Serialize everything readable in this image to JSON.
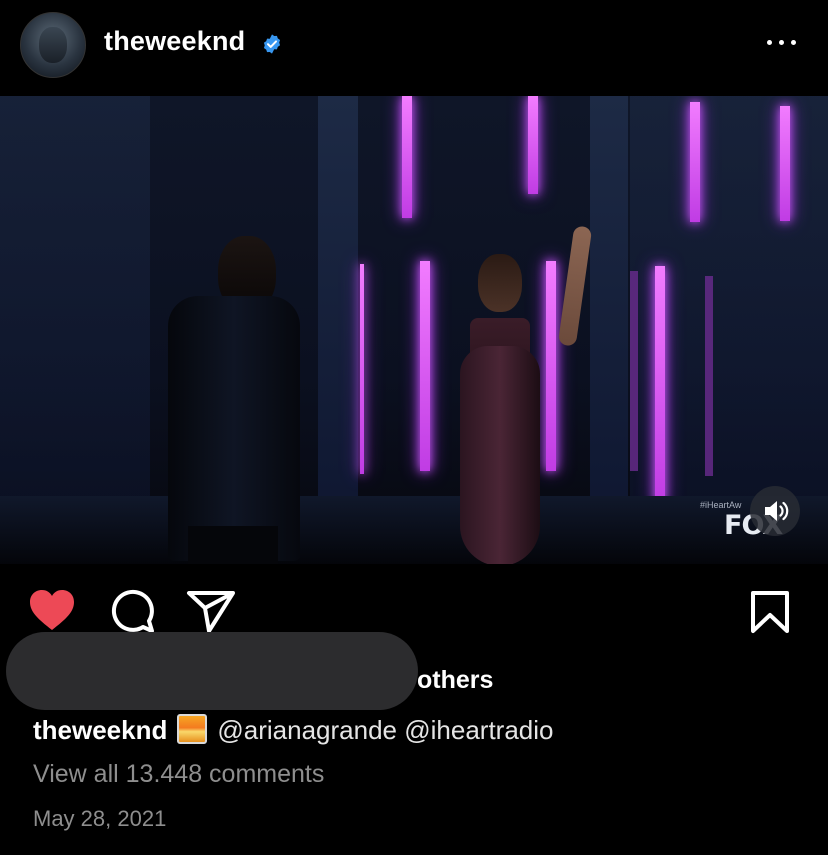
{
  "header": {
    "username": "theweeknd",
    "verified_icon": "verified-badge-icon",
    "avatar_icon": "avatar-image",
    "more_icon": "more-options-icon",
    "verified_color": "#3897f0"
  },
  "media": {
    "watermark_tag": "#iHeartAw",
    "network_logo": "FOX",
    "sound_icon": "speaker-volume-icon"
  },
  "actions": {
    "like_icon": "heart-filled-icon",
    "comment_icon": "comment-bubble-icon",
    "share_icon": "paper-plane-icon",
    "save_icon": "bookmark-icon",
    "like_color": "#ed4956"
  },
  "likes": {
    "suffix": "others"
  },
  "caption": {
    "username": "theweeknd",
    "emoji_icon": "sunset-emoji",
    "mention_1": "@arianagrande",
    "mention_2": "@iheartradio"
  },
  "comments": {
    "view_all": "View all 13.448 comments"
  },
  "post": {
    "date": "May 28, 2021"
  }
}
